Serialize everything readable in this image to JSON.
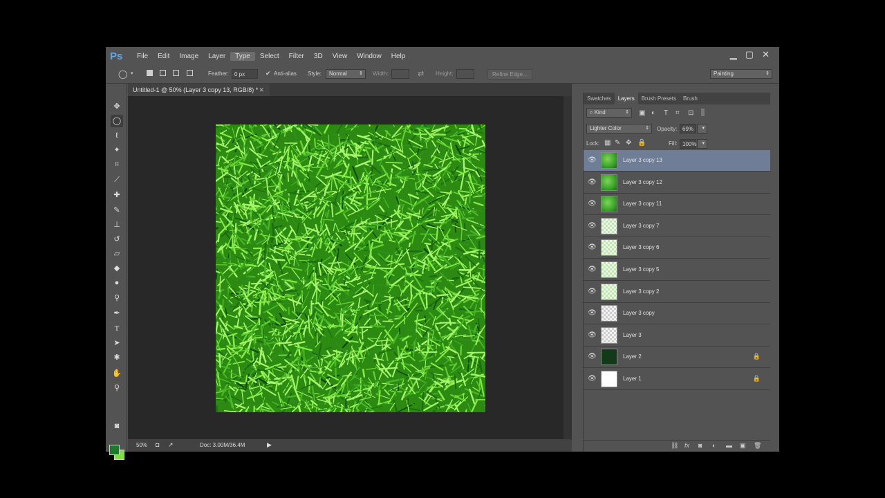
{
  "app": {
    "logo": "Ps"
  },
  "menu": [
    "File",
    "Edit",
    "Image",
    "Layer",
    "Type",
    "Select",
    "Filter",
    "3D",
    "View",
    "Window",
    "Help"
  ],
  "window_buttons": {
    "minimize": "▁",
    "maximize": "▢",
    "close": "✕"
  },
  "options": {
    "feather_label": "Feather:",
    "feather_value": "0 px",
    "antialias_label": "Anti-alias",
    "antialias_checked": true,
    "style_label": "Style:",
    "style_value": "Normal",
    "width_label": "Width:",
    "height_label": "Height:",
    "refine_edge": "Refine Edge...",
    "workspace": "Painting"
  },
  "document": {
    "tab_title": "Untitled-1 @ 50% (Layer 3 copy 13, RGB/8) *",
    "zoom": "50%",
    "doc_info": "Doc: 3.00M/36.4M"
  },
  "panel": {
    "tabs": [
      "Swatches",
      "Layers",
      "Brush Presets",
      "Brush"
    ],
    "active_tab": "Layers",
    "filter_kind": "Kind",
    "blend_mode": "Lighter Color",
    "opacity_label": "Opacity:",
    "opacity_value": "69%",
    "lock_label": "Lock:",
    "fill_label": "Fill:",
    "fill_value": "100%"
  },
  "layers": [
    {
      "name": "Layer 3 copy 13",
      "selected": true,
      "thumb": "grass",
      "locked": false
    },
    {
      "name": "Layer 3 copy 12",
      "selected": false,
      "thumb": "grass",
      "locked": false
    },
    {
      "name": "Layer 3 copy 11",
      "selected": false,
      "thumb": "grass",
      "locked": false
    },
    {
      "name": "Layer 3 copy 7",
      "selected": false,
      "thumb": "light",
      "locked": false
    },
    {
      "name": "Layer 3 copy 6",
      "selected": false,
      "thumb": "light",
      "locked": false
    },
    {
      "name": "Layer 3 copy 5",
      "selected": false,
      "thumb": "light",
      "locked": false
    },
    {
      "name": "Layer 3 copy 2",
      "selected": false,
      "thumb": "light",
      "locked": false
    },
    {
      "name": "Layer 3 copy",
      "selected": false,
      "thumb": "checker",
      "locked": false
    },
    {
      "name": "Layer 3",
      "selected": false,
      "thumb": "checker",
      "locked": false
    },
    {
      "name": "Layer 2",
      "selected": false,
      "thumb": "dark",
      "locked": true
    },
    {
      "name": "Layer 1",
      "selected": false,
      "thumb": "white",
      "locked": true
    }
  ],
  "colors": {
    "foreground": "#1a7a2a",
    "background": "#7ee03a",
    "selection": "#6f7d97"
  }
}
